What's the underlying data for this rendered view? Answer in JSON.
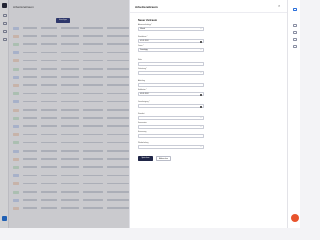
{
  "drawer": {
    "title": "Arbeitszeitraum",
    "section_title": "Neuer Zeitraum",
    "close_glyph": "×"
  },
  "form": {
    "absence_type": {
      "label": "Abwesenheitstyp *",
      "value": "Urlaub"
    },
    "start_date": {
      "label": "Startdatum *",
      "value": "01.01.2024"
    },
    "duration": {
      "label": "Dauer *",
      "value": "Ganztägig"
    },
    "note": {
      "label": "Notiz",
      "placeholder": ""
    },
    "substitute": {
      "label": "Vertretung *",
      "value": ""
    },
    "end_date": {
      "label": "Enddatum *",
      "value": "05.01.2024"
    },
    "approval": {
      "label": "Genehmigung *",
      "value": ""
    },
    "department": {
      "label": "Abteilung",
      "value": ""
    },
    "location": {
      "label": "Standort",
      "value": ""
    },
    "comment": {
      "label": "Kommentar",
      "value": ""
    },
    "reminder": {
      "label": "Erinnerung",
      "value": ""
    },
    "recurrence": {
      "label": "Wiederholung",
      "value": ""
    }
  },
  "buttons": {
    "submit": "Speichern",
    "cancel": "Abbrechen"
  },
  "background": {
    "title": "Arbeitszeitraum",
    "add_button": "Hinzufügen"
  },
  "colors": {
    "primary": "#1f2546",
    "accent": "#2a6fdb",
    "chat_bubble": "#e8542d"
  }
}
